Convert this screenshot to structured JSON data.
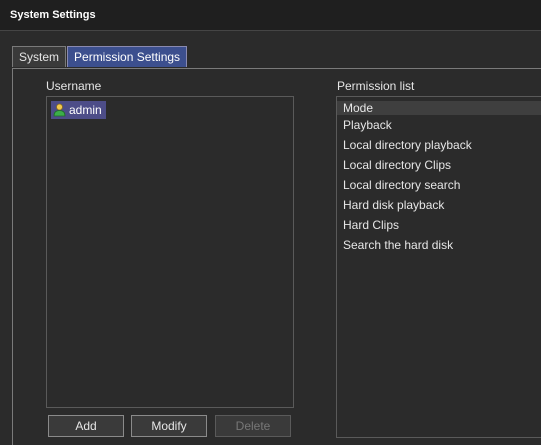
{
  "window": {
    "title": "System Settings"
  },
  "tabs": [
    {
      "label": "System",
      "active": false
    },
    {
      "label": "Permission Settings",
      "active": true
    }
  ],
  "users": {
    "label": "Username",
    "items": [
      {
        "name": "admin",
        "icon": "user-icon",
        "selected": true
      }
    ]
  },
  "permissions": {
    "label": "Permission list",
    "header": "Mode",
    "items": [
      "Playback",
      "Local directory playback",
      "Local directory Clips",
      "Local directory search",
      "Hard disk playback",
      "Hard Clips",
      "Search the hard disk"
    ]
  },
  "buttons": {
    "add": "Add",
    "modify": "Modify",
    "delete": "Delete",
    "delete_enabled": false
  },
  "colors": {
    "background": "#2b2b2b",
    "active_tab": "#3c4f8e",
    "selection": "#4d4d88"
  }
}
